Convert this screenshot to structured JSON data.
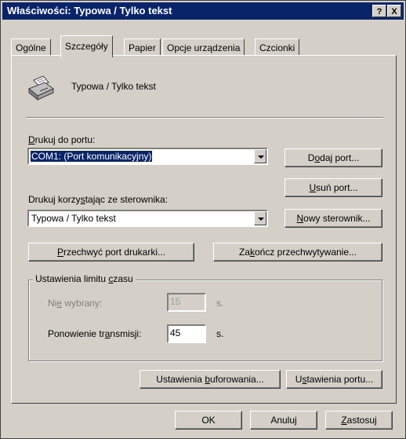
{
  "window": {
    "title": "Właściwości: Typowa / Tylko tekst"
  },
  "titlebar_buttons": {
    "help": "?",
    "close": "X"
  },
  "tabs": [
    {
      "label": "Ogólne"
    },
    {
      "label": "Szczegóły"
    },
    {
      "label": "Papier"
    },
    {
      "label": "Opcje urządzenia"
    },
    {
      "label": "Czcionki"
    }
  ],
  "active_tab": "Szczegóły",
  "printer": {
    "name": "Typowa / Tylko tekst",
    "icon": "printer-icon"
  },
  "port": {
    "label_pre": "",
    "label_key": "D",
    "label_post": "rukuj do portu:",
    "value": "COM1:  (Port komunikacyjny)",
    "add_port": {
      "pre": "D",
      "key": "o",
      "post": "daj port..."
    },
    "remove_port": {
      "pre": "",
      "key": "U",
      "post": "suń port..."
    }
  },
  "driver": {
    "label_pre": "Drukuj korzy",
    "label_key": "s",
    "label_post": "tając ze sterownika:",
    "value": "Typowa / Tylko tekst",
    "new_driver": {
      "pre": "",
      "key": "N",
      "post": "owy sterownik..."
    }
  },
  "capture": {
    "capture_port": {
      "pre": "",
      "key": "P",
      "post": "rzechwyć port drukarki..."
    },
    "end_capture": {
      "pre": "Za",
      "key": "k",
      "post": "ończ przechwytywanie..."
    }
  },
  "timeout": {
    "group_label_pre": "Ustawienia limitu ",
    "group_label_key": "c",
    "group_label_post": "zasu",
    "not_selected": {
      "pre": "Ni",
      "key": "e",
      "post": " wybrany:",
      "value": "15",
      "unit": "s."
    },
    "retry": {
      "pre": "Ponowienie tr",
      "key": "a",
      "post": "nsmisji:",
      "value": "45",
      "unit": "s."
    }
  },
  "bottom_buttons": {
    "spool": {
      "pre": "Ustawienia ",
      "key": "b",
      "post": "uforowania..."
    },
    "port_settings": {
      "pre": "U",
      "key": "s",
      "post": "tawienia portu..."
    }
  },
  "dialog_buttons": {
    "ok": "OK",
    "cancel": "Anuluj",
    "apply": {
      "pre": "",
      "key": "Z",
      "post": "astosuj"
    }
  }
}
